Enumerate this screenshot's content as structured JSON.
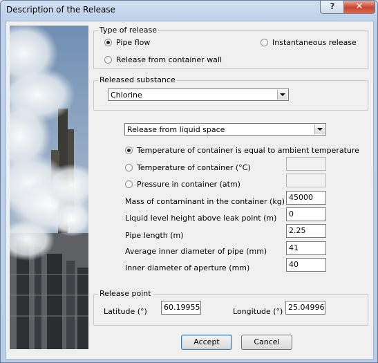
{
  "window": {
    "title": "Description of the Release",
    "help_label": "?",
    "close_label": "✕"
  },
  "release_type": {
    "legend": "Type of release",
    "options": [
      {
        "label": "Pipe flow",
        "selected": true
      },
      {
        "label": "Instantaneous release",
        "selected": false
      },
      {
        "label": "Release from container wall",
        "selected": false
      }
    ]
  },
  "substance": {
    "legend": "Released substance",
    "value": "Chlorine"
  },
  "source": {
    "mode_value": "Release from liquid space",
    "temp_options": [
      {
        "label": "Temperature of container is equal to ambient temperature",
        "selected": true
      },
      {
        "label": "Temperature of container  (°C)",
        "selected": false
      },
      {
        "label": "Pressure in container  (atm)",
        "selected": false
      }
    ],
    "fields": [
      {
        "label": "Mass of contaminant in the container  (kg)",
        "value": "45000"
      },
      {
        "label": "Liquid level height above leak point  (m)",
        "value": "0"
      },
      {
        "label": "Pipe length  (m)",
        "value": "2.25"
      },
      {
        "label": "Average inner diameter of pipe  (mm)",
        "value": "41"
      },
      {
        "label": "Inner diameter of aperture  (mm)",
        "value": "40"
      }
    ]
  },
  "release_point": {
    "legend": "Release point",
    "latitude_label": "Latitude (°)",
    "latitude_value": "60.19955",
    "longitude_label": "Longitude (°)",
    "longitude_value": "25.04996"
  },
  "buttons": {
    "accept": "Accept",
    "cancel": "Cancel"
  }
}
